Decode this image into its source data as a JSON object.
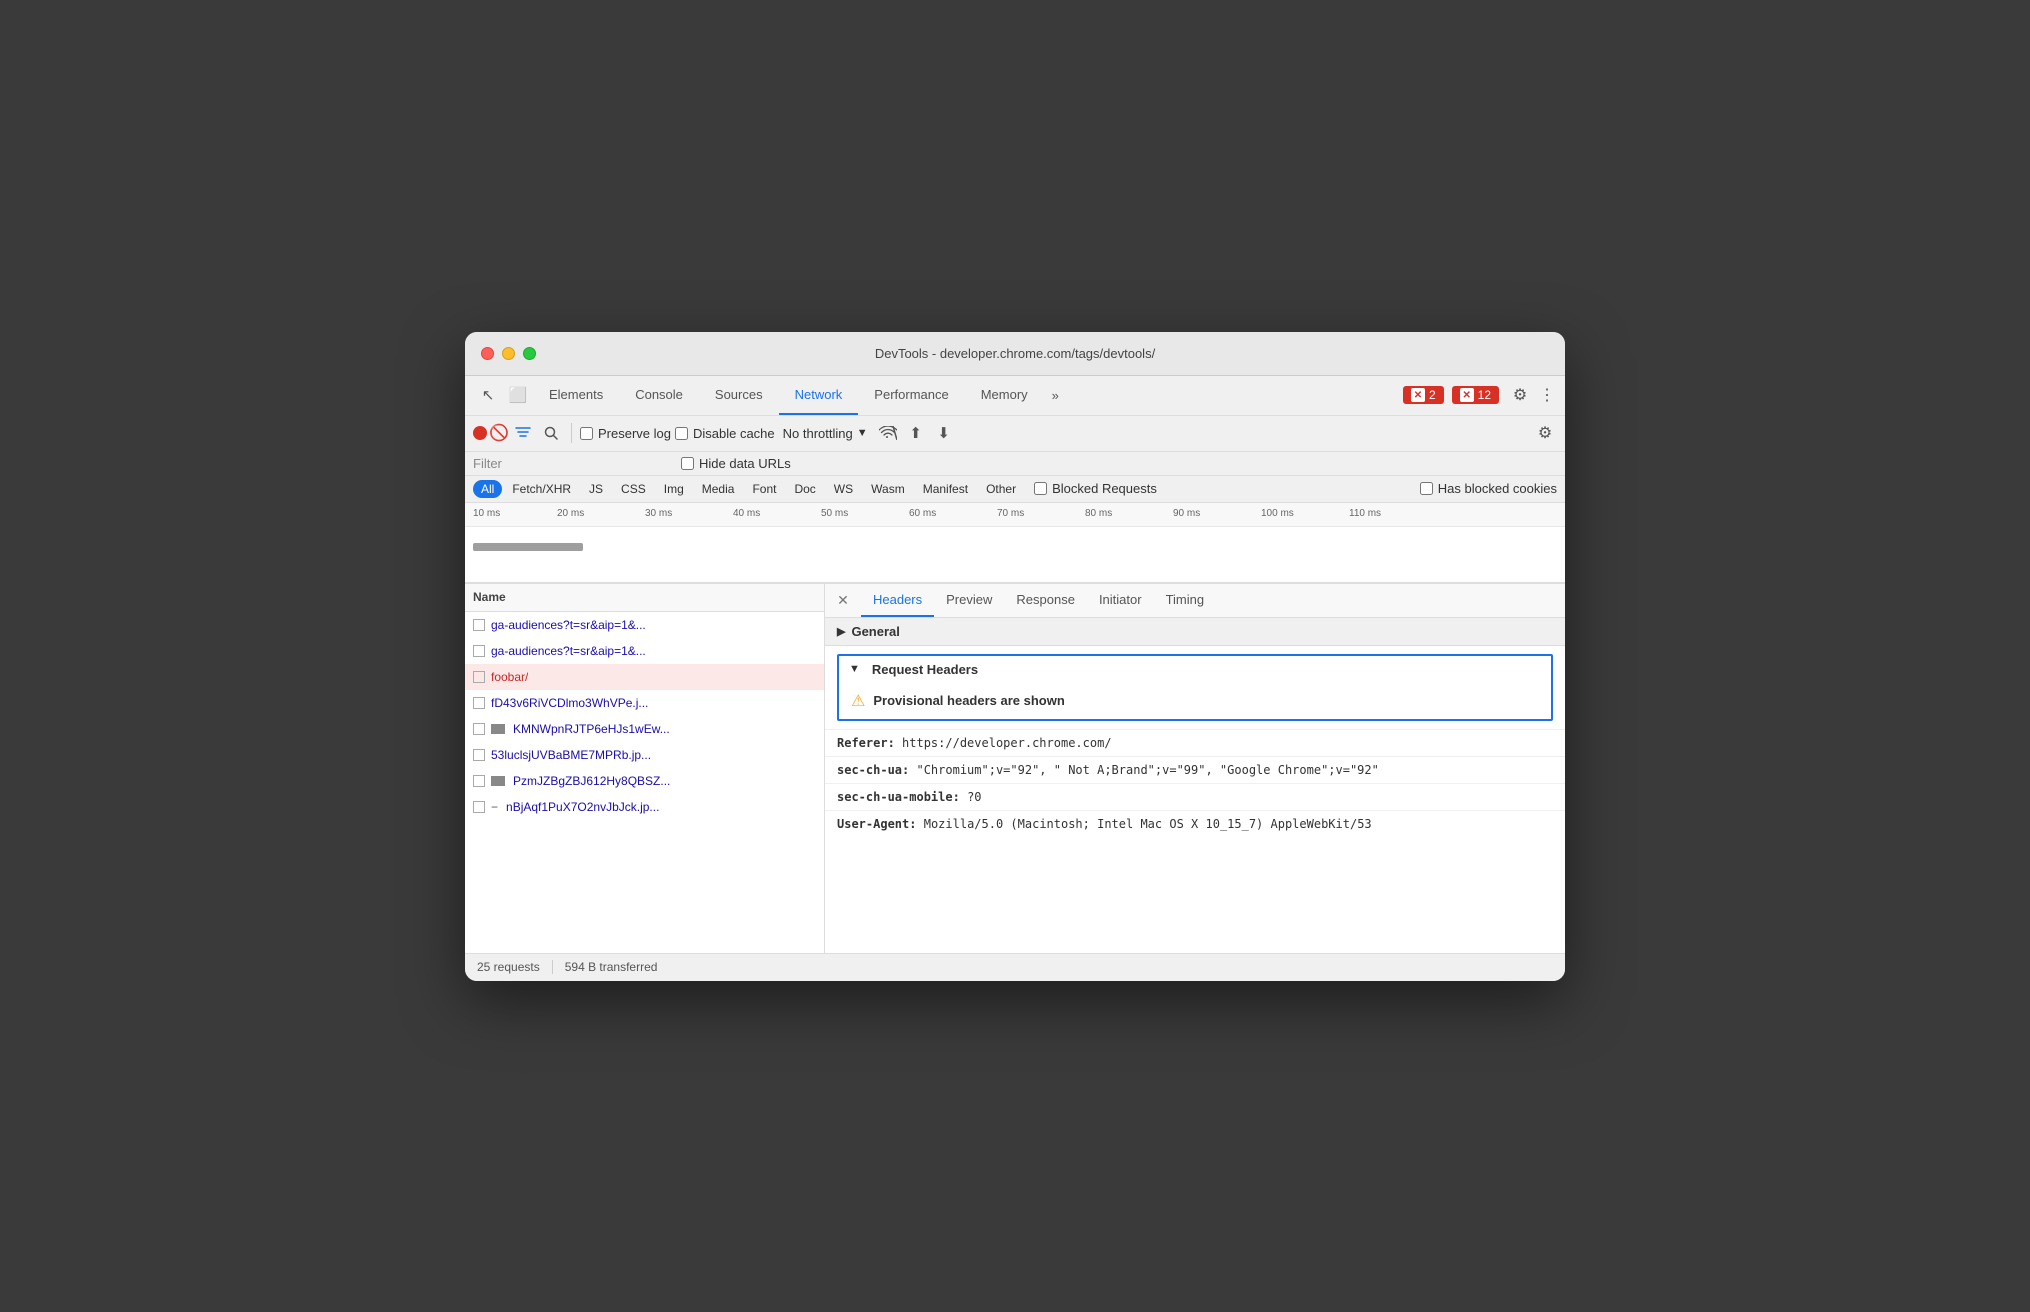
{
  "window": {
    "title": "DevTools - developer.chrome.com/tags/devtools/"
  },
  "titlebar_buttons": {
    "close": "●",
    "minimize": "●",
    "maximize": "●"
  },
  "devtools_tabs": {
    "tools": [
      "↖",
      "⬜"
    ],
    "tabs": [
      "Elements",
      "Console",
      "Sources",
      "Network",
      "Performance",
      "Memory"
    ],
    "active": "Network",
    "more": "»",
    "error_badge": "2",
    "warn_badge": "12",
    "gear_icon": "⚙",
    "dots_icon": "⋮"
  },
  "network_toolbar": {
    "preserve_log_label": "Preserve log",
    "disable_cache_label": "Disable cache",
    "no_throttling_label": "No throttling",
    "filter_placeholder": "Filter",
    "hide_data_urls_label": "Hide data URLs"
  },
  "type_filters": {
    "types": [
      "All",
      "Fetch/XHR",
      "JS",
      "CSS",
      "Img",
      "Media",
      "Font",
      "Doc",
      "WS",
      "Wasm",
      "Manifest",
      "Other"
    ],
    "active": "All",
    "blocked_requests_label": "Blocked Requests",
    "has_blocked_cookies_label": "Has blocked cookies"
  },
  "timeline": {
    "ticks": [
      "10 ms",
      "20 ms",
      "30 ms",
      "40 ms",
      "50 ms",
      "60 ms",
      "70 ms",
      "80 ms",
      "90 ms",
      "100 ms",
      "110 ms"
    ]
  },
  "file_list": {
    "header": "Name",
    "items": [
      {
        "name": "ga-audiences?t=sr&aip=1&...",
        "type": "img",
        "selected": false
      },
      {
        "name": "ga-audiences?t=sr&aip=1&...",
        "type": "img",
        "selected": false
      },
      {
        "name": "foobar/",
        "type": "doc",
        "selected": true
      },
      {
        "name": "fD43v6RiVCDlmo3WhVPe.j...",
        "type": "js",
        "selected": false
      },
      {
        "name": "KMNWpnRJTP6eHJs1wEw...",
        "type": "img",
        "selected": false
      },
      {
        "name": "53luclsjUVBaBME7MPRb.jp...",
        "type": "img",
        "selected": false
      },
      {
        "name": "PzmJZBgZBJ612Hy8QBSZ...",
        "type": "img",
        "selected": false
      },
      {
        "name": "nBjAqf1PuX7O2nvJbJck.jp...",
        "type": "img",
        "selected": false
      }
    ]
  },
  "detail_panel": {
    "tabs": [
      "Headers",
      "Preview",
      "Response",
      "Initiator",
      "Timing"
    ],
    "active_tab": "Headers",
    "general_section": "General",
    "request_headers_title": "Request Headers",
    "provisional_warning": "Provisional headers are shown",
    "headers": [
      {
        "key": "Referer:",
        "value": " https://developer.chrome.com/"
      },
      {
        "key": "sec-ch-ua:",
        "value": " \"Chromium\";v=\"92\", \" Not A;Brand\";v=\"99\", \"Google Chrome\";v=\"92\""
      },
      {
        "key": "sec-ch-ua-mobile:",
        "value": " ?0"
      },
      {
        "key": "User-Agent:",
        "value": " Mozilla/5.0 (Macintosh; Intel Mac OS X 10_15_7) AppleWebKit/53"
      }
    ]
  },
  "status_bar": {
    "requests": "25 requests",
    "transferred": "594 B transferred"
  }
}
